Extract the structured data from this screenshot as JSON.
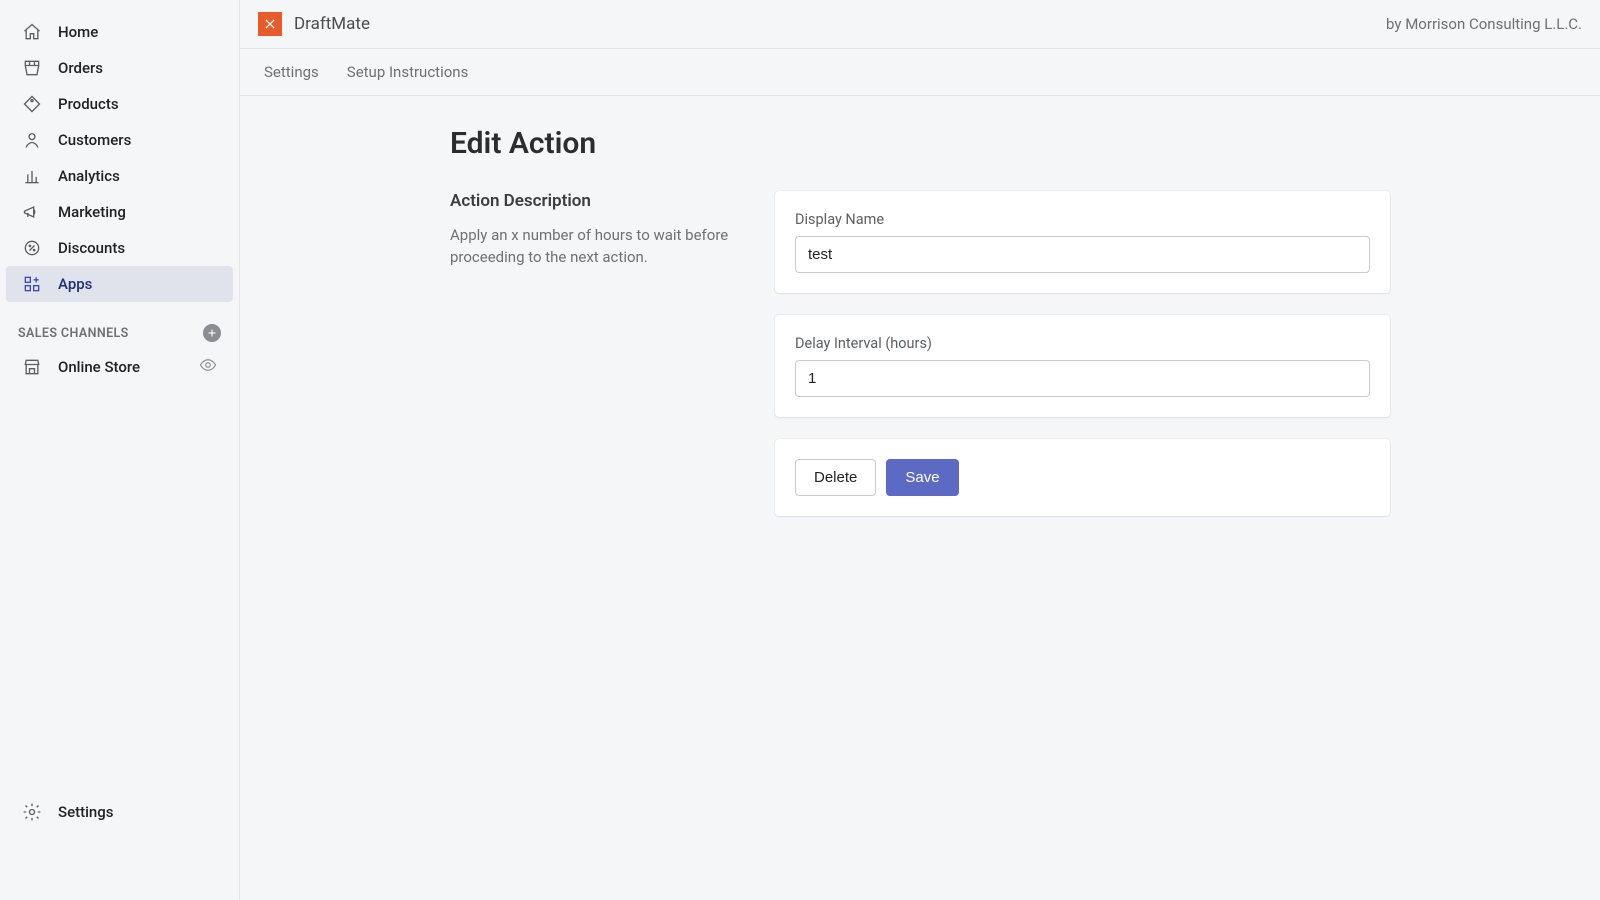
{
  "sidebar": {
    "items": [
      {
        "label": "Home"
      },
      {
        "label": "Orders"
      },
      {
        "label": "Products"
      },
      {
        "label": "Customers"
      },
      {
        "label": "Analytics"
      },
      {
        "label": "Marketing"
      },
      {
        "label": "Discounts"
      },
      {
        "label": "Apps"
      }
    ],
    "sales_channels_heading": "SALES CHANNELS",
    "channels": [
      {
        "label": "Online Store"
      }
    ],
    "footer": {
      "settings_label": "Settings"
    }
  },
  "header": {
    "app_name": "DraftMate",
    "byline": "by Morrison Consulting L.L.C."
  },
  "tabs": [
    {
      "label": "Settings"
    },
    {
      "label": "Setup Instructions"
    }
  ],
  "page": {
    "title": "Edit Action",
    "annotation": {
      "heading": "Action Description",
      "body": "Apply an x number of hours to wait before proceeding to the next action."
    },
    "fields": {
      "display_name": {
        "label": "Display Name",
        "value": "test"
      },
      "delay_interval": {
        "label": "Delay Interval (hours)",
        "value": "1"
      }
    },
    "buttons": {
      "delete": "Delete",
      "save": "Save"
    }
  }
}
